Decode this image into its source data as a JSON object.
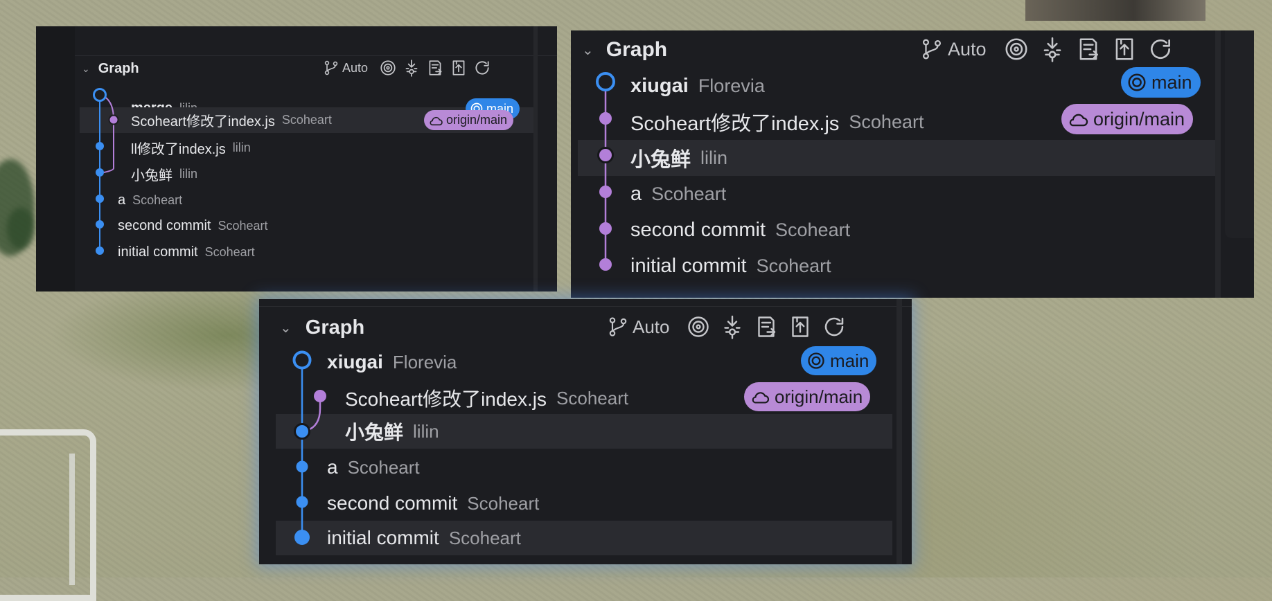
{
  "colors": {
    "blue": "#3b8ff2",
    "purple": "#b37fd9",
    "panel": "#1c1d21",
    "highlight": "#2a2b30"
  },
  "panels": [
    {
      "title": "Graph",
      "toolbar": {
        "auto_label": "Auto",
        "icons": [
          "branch-icon",
          "target-icon",
          "fetch-icon",
          "pull-icon",
          "push-icon",
          "refresh-icon"
        ]
      },
      "commits": [
        {
          "message": "merge",
          "author": "lilin",
          "bold": true
        },
        {
          "message": "Scoheart修改了index.js",
          "author": "Scoheart"
        },
        {
          "message": "ll修改了index.js",
          "author": "lilin"
        },
        {
          "message": "小兔鲜",
          "author": "lilin"
        },
        {
          "message": "a",
          "author": "Scoheart"
        },
        {
          "message": "second commit",
          "author": "Scoheart"
        },
        {
          "message": "initial commit",
          "author": "Scoheart"
        }
      ],
      "badges": {
        "main": "main",
        "origin": "origin/main"
      }
    },
    {
      "title": "Graph",
      "toolbar": {
        "auto_label": "Auto",
        "icons": [
          "branch-icon",
          "target-icon",
          "fetch-icon",
          "pull-icon",
          "push-icon",
          "refresh-icon"
        ]
      },
      "commits": [
        {
          "message": "xiugai",
          "author": "Florevia",
          "bold": true
        },
        {
          "message": "Scoheart修改了index.js",
          "author": "Scoheart"
        },
        {
          "message": "小兔鲜",
          "author": "lilin"
        },
        {
          "message": "a",
          "author": "Scoheart"
        },
        {
          "message": "second commit",
          "author": "Scoheart"
        },
        {
          "message": "initial commit",
          "author": "Scoheart"
        }
      ],
      "badges": {
        "main": "main",
        "origin": "origin/main"
      }
    },
    {
      "title": "Graph",
      "toolbar": {
        "auto_label": "Auto",
        "icons": [
          "branch-icon",
          "target-icon",
          "fetch-icon",
          "pull-icon",
          "push-icon",
          "refresh-icon"
        ]
      },
      "commits": [
        {
          "message": "xiugai",
          "author": "Florevia",
          "bold": true
        },
        {
          "message": "Scoheart修改了index.js",
          "author": "Scoheart"
        },
        {
          "message": "小兔鲜",
          "author": "lilin"
        },
        {
          "message": "a",
          "author": "Scoheart"
        },
        {
          "message": "second commit",
          "author": "Scoheart"
        },
        {
          "message": "initial commit",
          "author": "Scoheart"
        }
      ],
      "badges": {
        "main": "main",
        "origin": "origin/main"
      }
    }
  ]
}
